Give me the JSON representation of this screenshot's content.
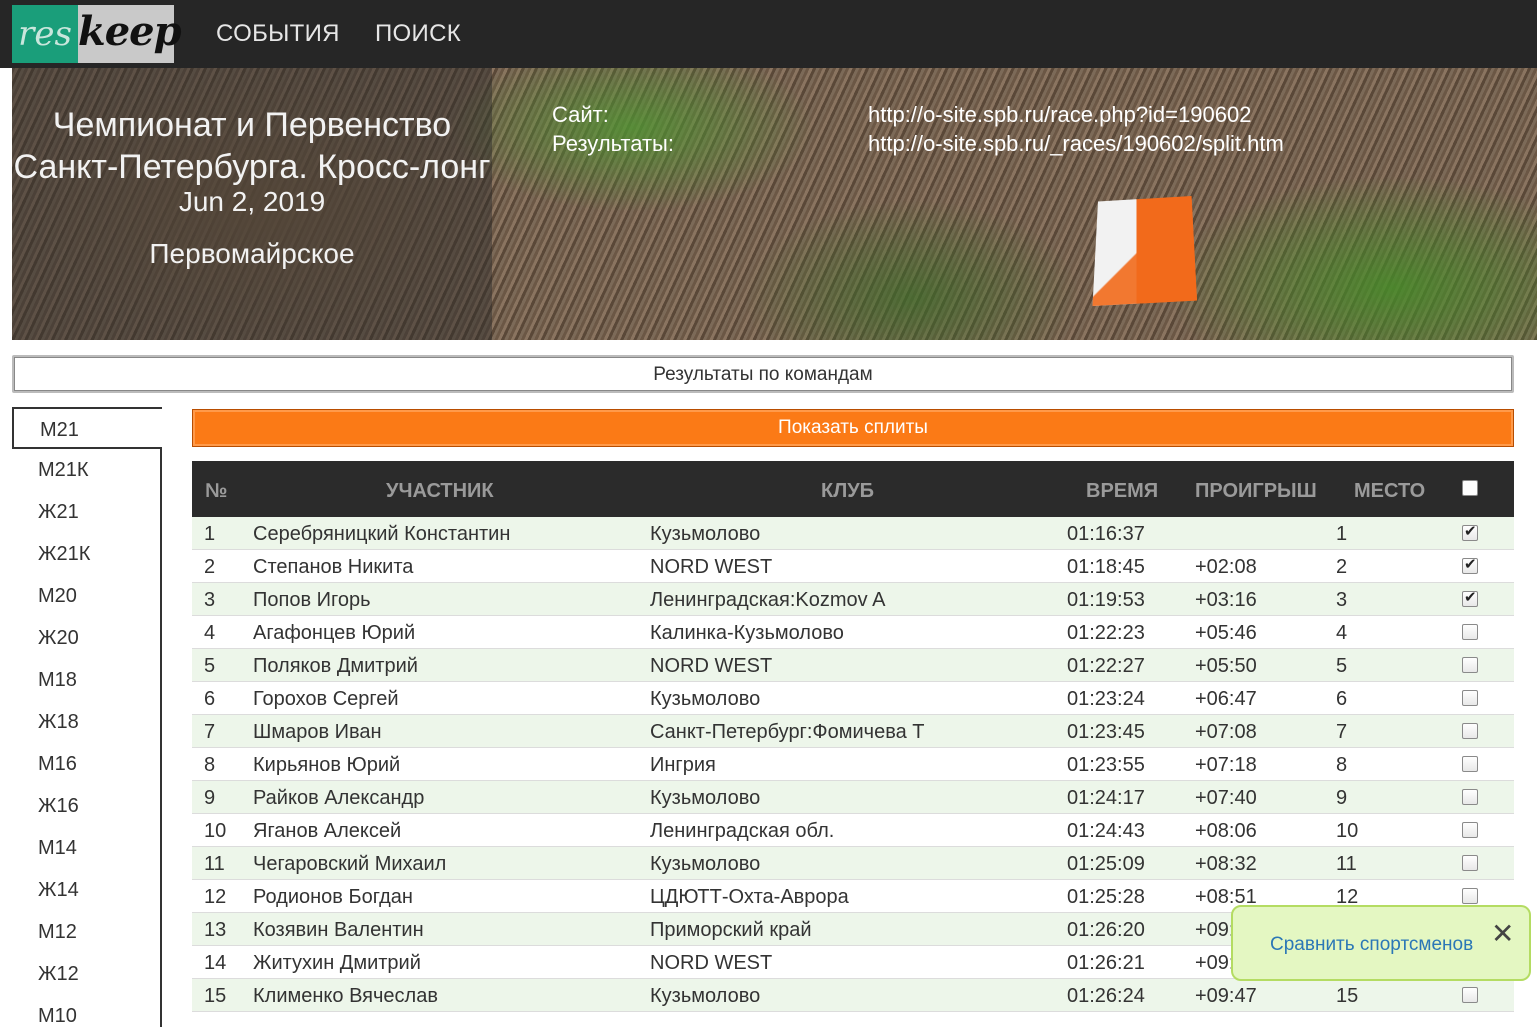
{
  "logo": {
    "part1": "res",
    "part2": "keep"
  },
  "nav": {
    "events": "СОБЫТИЯ",
    "search": "ПОИСК"
  },
  "event": {
    "title_line1": "Чемпионат и Первенство",
    "title_line2": "Санкт-Петербурга. Кросс-лонг",
    "date": "Jun 2, 2019",
    "place": "Первомайрское",
    "site_label": "Сайт:",
    "site_url": "http://o-site.spb.ru/race.php?id=190602",
    "results_label": "Результаты:",
    "results_url": "http://o-site.spb.ru/_races/190602/split.htm"
  },
  "team_results_label": "Результаты по командам",
  "show_splits_label": "Показать сплиты",
  "categories": [
    "М21",
    "М21К",
    "Ж21",
    "Ж21К",
    "М20",
    "Ж20",
    "М18",
    "Ж18",
    "М16",
    "Ж16",
    "М14",
    "Ж14",
    "М12",
    "Ж12",
    "М10"
  ],
  "active_category": "М21",
  "table": {
    "headers": {
      "num": "№",
      "name": "УЧАСТНИК",
      "club": "КЛУБ",
      "time": "ВРЕМЯ",
      "loss": "ПРОИГРЫШ",
      "place": "МЕСТО"
    },
    "rows": [
      {
        "num": "1",
        "name": "Серебряницкий Константин",
        "club": "Кузьмолово",
        "time": "01:16:37",
        "loss": "",
        "place": "1",
        "checked": true
      },
      {
        "num": "2",
        "name": "Степанов Никита",
        "club": "NORD WEST",
        "time": "01:18:45",
        "loss": "+02:08",
        "place": "2",
        "checked": true
      },
      {
        "num": "3",
        "name": "Попов Игорь",
        "club": "Ленинградская:Kozmov A",
        "time": "01:19:53",
        "loss": "+03:16",
        "place": "3",
        "checked": true
      },
      {
        "num": "4",
        "name": "Агафонцев Юрий",
        "club": "Калинка-Кузьмолово",
        "time": "01:22:23",
        "loss": "+05:46",
        "place": "4",
        "checked": false
      },
      {
        "num": "5",
        "name": "Поляков Дмитрий",
        "club": "NORD WEST",
        "time": "01:22:27",
        "loss": "+05:50",
        "place": "5",
        "checked": false
      },
      {
        "num": "6",
        "name": "Горохов Сергей",
        "club": "Кузьмолово",
        "time": "01:23:24",
        "loss": "+06:47",
        "place": "6",
        "checked": false
      },
      {
        "num": "7",
        "name": "Шмаров Иван",
        "club": "Санкт-Петербург:Фомичева Т",
        "time": "01:23:45",
        "loss": "+07:08",
        "place": "7",
        "checked": false
      },
      {
        "num": "8",
        "name": "Кирьянов Юрий",
        "club": "Ингрия",
        "time": "01:23:55",
        "loss": "+07:18",
        "place": "8",
        "checked": false
      },
      {
        "num": "9",
        "name": "Райков Александр",
        "club": "Кузьмолово",
        "time": "01:24:17",
        "loss": "+07:40",
        "place": "9",
        "checked": false
      },
      {
        "num": "10",
        "name": "Яганов Алексей",
        "club": "Ленинградская обл.",
        "time": "01:24:43",
        "loss": "+08:06",
        "place": "10",
        "checked": false
      },
      {
        "num": "11",
        "name": "Чегаровский Михаил",
        "club": "Кузьмолово",
        "time": "01:25:09",
        "loss": "+08:32",
        "place": "11",
        "checked": false
      },
      {
        "num": "12",
        "name": "Родионов Богдан",
        "club": "ЦДЮТТ-Охта-Аврора",
        "time": "01:25:28",
        "loss": "+08:51",
        "place": "12",
        "checked": false
      },
      {
        "num": "13",
        "name": "Козявин Валентин",
        "club": "Приморский край",
        "time": "01:26:20",
        "loss": "+09:",
        "place": "",
        "checked": false
      },
      {
        "num": "14",
        "name": "Житухин Дмитрий",
        "club": "NORD WEST",
        "time": "01:26:21",
        "loss": "+09:",
        "place": "",
        "checked": false
      },
      {
        "num": "15",
        "name": "Клименко Вячеслав",
        "club": "Кузьмолово",
        "time": "01:26:24",
        "loss": "+09:47",
        "place": "15",
        "checked": false
      }
    ]
  },
  "compare": {
    "label": "Сравнить спортсменов",
    "close": "✕"
  },
  "colors": {
    "accent": "#fb7a16",
    "row_highlight": "#edf6ea",
    "header_bg": "#2b2b2b",
    "popup_bg": "#e4f7c2"
  }
}
